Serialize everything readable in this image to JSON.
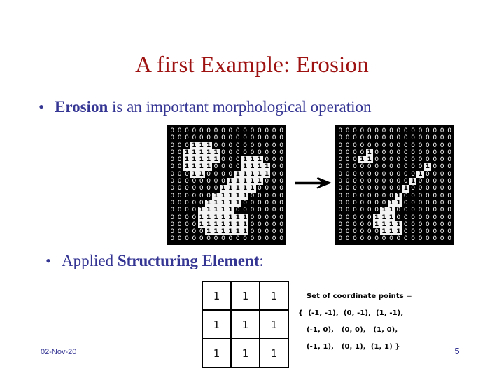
{
  "slide": {
    "title": "A first Example: Erosion",
    "title_color": "#9E1212",
    "body_color": "#353594",
    "background": "#ffffff"
  },
  "bullets": [
    {
      "marker": "•",
      "lead_bold": "Erosion",
      "rest": " is an important morphological operation",
      "full_text": "Erosion is an important morphological operation"
    },
    {
      "marker": "•",
      "prefix": "Applied ",
      "bold": "Structuring Element",
      "suffix": ":",
      "full_text": "Applied Structuring Element:"
    }
  ],
  "arrow": {
    "name": "right-arrow",
    "glyph": "→",
    "color": "#000000"
  },
  "matrices": {
    "original": {
      "label": "original binary image",
      "rows": 16,
      "cols": 16,
      "zero_glyph": "0",
      "one_glyph": "1",
      "grid": [
        [
          0,
          0,
          0,
          0,
          0,
          0,
          0,
          0,
          0,
          0,
          0,
          0,
          0,
          0,
          0,
          0
        ],
        [
          0,
          0,
          0,
          0,
          0,
          0,
          0,
          0,
          0,
          0,
          0,
          0,
          0,
          0,
          0,
          0
        ],
        [
          0,
          0,
          0,
          1,
          1,
          1,
          0,
          0,
          0,
          0,
          0,
          0,
          0,
          0,
          0,
          0
        ],
        [
          0,
          0,
          1,
          1,
          1,
          1,
          1,
          0,
          0,
          0,
          0,
          0,
          0,
          0,
          0,
          0
        ],
        [
          0,
          0,
          1,
          1,
          1,
          1,
          1,
          0,
          0,
          0,
          1,
          1,
          1,
          0,
          0,
          0
        ],
        [
          0,
          0,
          1,
          1,
          1,
          1,
          0,
          0,
          0,
          0,
          1,
          1,
          1,
          1,
          0,
          0
        ],
        [
          0,
          0,
          0,
          1,
          1,
          0,
          0,
          0,
          0,
          1,
          1,
          1,
          1,
          1,
          0,
          0
        ],
        [
          0,
          0,
          0,
          0,
          0,
          0,
          0,
          0,
          1,
          1,
          1,
          1,
          1,
          0,
          0,
          0
        ],
        [
          0,
          0,
          0,
          0,
          0,
          0,
          0,
          1,
          1,
          1,
          1,
          1,
          0,
          0,
          0,
          0
        ],
        [
          0,
          0,
          0,
          0,
          0,
          0,
          1,
          1,
          1,
          1,
          1,
          0,
          0,
          0,
          0,
          0
        ],
        [
          0,
          0,
          0,
          0,
          0,
          1,
          1,
          1,
          1,
          1,
          0,
          0,
          0,
          0,
          0,
          0
        ],
        [
          0,
          0,
          0,
          0,
          1,
          1,
          1,
          1,
          1,
          0,
          0,
          0,
          0,
          0,
          0,
          0
        ],
        [
          0,
          0,
          0,
          0,
          1,
          1,
          1,
          1,
          1,
          1,
          1,
          0,
          0,
          0,
          0,
          0
        ],
        [
          0,
          0,
          0,
          0,
          1,
          1,
          1,
          1,
          1,
          1,
          1,
          0,
          0,
          0,
          0,
          0
        ],
        [
          0,
          0,
          0,
          0,
          0,
          1,
          1,
          1,
          1,
          1,
          1,
          0,
          0,
          0,
          0,
          0
        ],
        [
          0,
          0,
          0,
          0,
          0,
          0,
          0,
          0,
          0,
          0,
          0,
          0,
          0,
          0,
          0,
          0
        ]
      ]
    },
    "eroded": {
      "label": "eroded binary image",
      "rows": 16,
      "cols": 16,
      "zero_glyph": "0",
      "one_glyph": "1",
      "grid": [
        [
          0,
          0,
          0,
          0,
          0,
          0,
          0,
          0,
          0,
          0,
          0,
          0,
          0,
          0,
          0,
          0
        ],
        [
          0,
          0,
          0,
          0,
          0,
          0,
          0,
          0,
          0,
          0,
          0,
          0,
          0,
          0,
          0,
          0
        ],
        [
          0,
          0,
          0,
          0,
          0,
          0,
          0,
          0,
          0,
          0,
          0,
          0,
          0,
          0,
          0,
          0
        ],
        [
          0,
          0,
          0,
          0,
          1,
          0,
          0,
          0,
          0,
          0,
          0,
          0,
          0,
          0,
          0,
          0
        ],
        [
          0,
          0,
          0,
          1,
          1,
          0,
          0,
          0,
          0,
          0,
          0,
          0,
          0,
          0,
          0,
          0
        ],
        [
          0,
          0,
          0,
          0,
          0,
          0,
          0,
          0,
          0,
          0,
          0,
          0,
          1,
          0,
          0,
          0
        ],
        [
          0,
          0,
          0,
          0,
          0,
          0,
          0,
          0,
          0,
          0,
          0,
          1,
          0,
          0,
          0,
          0
        ],
        [
          0,
          0,
          0,
          0,
          0,
          0,
          0,
          0,
          0,
          0,
          1,
          0,
          0,
          0,
          0,
          0
        ],
        [
          0,
          0,
          0,
          0,
          0,
          0,
          0,
          0,
          0,
          1,
          0,
          0,
          0,
          0,
          0,
          0
        ],
        [
          0,
          0,
          0,
          0,
          0,
          0,
          0,
          0,
          1,
          0,
          0,
          0,
          0,
          0,
          0,
          0
        ],
        [
          0,
          0,
          0,
          0,
          0,
          0,
          0,
          1,
          1,
          0,
          0,
          0,
          0,
          0,
          0,
          0
        ],
        [
          0,
          0,
          0,
          0,
          0,
          0,
          1,
          1,
          0,
          0,
          0,
          0,
          0,
          0,
          0,
          0
        ],
        [
          0,
          0,
          0,
          0,
          0,
          1,
          1,
          1,
          0,
          0,
          0,
          0,
          0,
          0,
          0,
          0
        ],
        [
          0,
          0,
          0,
          0,
          0,
          1,
          1,
          1,
          1,
          0,
          0,
          0,
          0,
          0,
          0,
          0
        ],
        [
          0,
          0,
          0,
          0,
          0,
          0,
          1,
          1,
          1,
          0,
          0,
          0,
          0,
          0,
          0,
          0
        ],
        [
          0,
          0,
          0,
          0,
          0,
          0,
          0,
          0,
          0,
          0,
          0,
          0,
          0,
          0,
          0,
          0
        ]
      ]
    }
  },
  "structuring_element": {
    "rows": 3,
    "cols": 3,
    "values": [
      [
        "1",
        "1",
        "1"
      ],
      [
        "1",
        "1",
        "1"
      ],
      [
        "1",
        "1",
        "1"
      ]
    ]
  },
  "coordinate_set": {
    "heading": "Set of coordinate points =",
    "lines": [
      "{  (-1, -1),  (0, -1),  (1, -1),",
      "(-1, 0),   (0, 0),   (1, 0),",
      "(-1, 1),   (0, 1),  (1, 1) }"
    ]
  },
  "footer": {
    "date": "02-Nov-20",
    "page_number": "5"
  }
}
